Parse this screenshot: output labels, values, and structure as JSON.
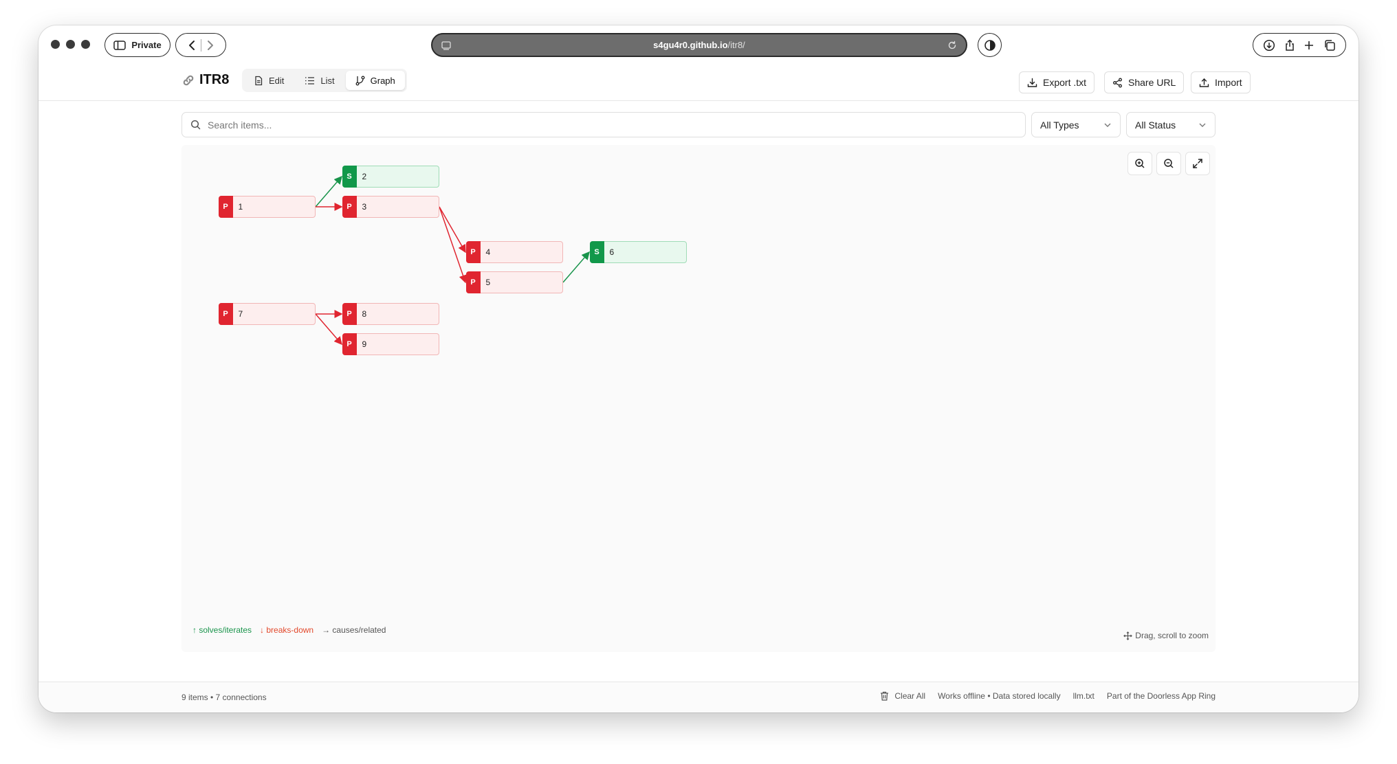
{
  "browser": {
    "private_label": "Private",
    "url_host": "s4gu4r0.github.io",
    "url_path": "/itr8/"
  },
  "app": {
    "title": "ITR8",
    "tabs": [
      {
        "label": "Edit",
        "icon": "document-icon"
      },
      {
        "label": "List",
        "icon": "list-icon"
      },
      {
        "label": "Graph",
        "icon": "git-branch-icon",
        "active": true
      }
    ],
    "actions": {
      "export": "Export .txt",
      "share": "Share URL",
      "import": "Import"
    }
  },
  "toolbar": {
    "search_placeholder": "Search items...",
    "type_filter": "All Types",
    "status_filter": "All Status"
  },
  "graph": {
    "nodes": [
      {
        "id": "1",
        "kind": "P",
        "label": "1"
      },
      {
        "id": "2",
        "kind": "S",
        "label": "2"
      },
      {
        "id": "3",
        "kind": "P",
        "label": "3"
      },
      {
        "id": "4",
        "kind": "P",
        "label": "4"
      },
      {
        "id": "5",
        "kind": "P",
        "label": "5"
      },
      {
        "id": "6",
        "kind": "S",
        "label": "6"
      },
      {
        "id": "7",
        "kind": "P",
        "label": "7"
      },
      {
        "id": "8",
        "kind": "P",
        "label": "8"
      },
      {
        "id": "9",
        "kind": "P",
        "label": "9"
      }
    ],
    "edges": [
      {
        "from": "1",
        "to": "2",
        "type": "solves"
      },
      {
        "from": "1",
        "to": "3",
        "type": "breaks-down"
      },
      {
        "from": "3",
        "to": "4",
        "type": "breaks-down"
      },
      {
        "from": "3",
        "to": "5",
        "type": "breaks-down"
      },
      {
        "from": "5",
        "to": "6",
        "type": "solves"
      },
      {
        "from": "7",
        "to": "8",
        "type": "breaks-down"
      },
      {
        "from": "7",
        "to": "9",
        "type": "breaks-down"
      }
    ],
    "legend": {
      "solves": "↑ solves/iterates",
      "breaks": "↓ breaks-down",
      "causes": "→ causes/related"
    },
    "hint": "Drag, scroll to zoom",
    "colors": {
      "solves": "#19944b",
      "breaks": "#e02530"
    }
  },
  "footer": {
    "stats": "9 items • 7 connections",
    "clear_all": "Clear All",
    "offline": "Works offline • Data stored locally",
    "llm": "llm.txt",
    "ring": "Part of the Doorless App Ring"
  }
}
